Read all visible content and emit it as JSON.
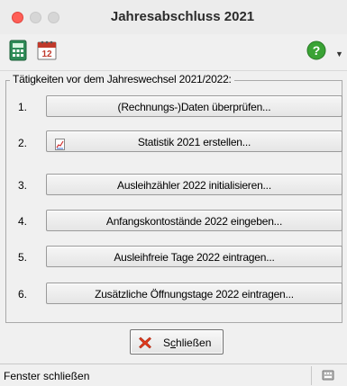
{
  "window": {
    "title": "Jahresabschluss 2021"
  },
  "toolbar": {
    "icons": [
      "calculator-icon",
      "calendar-icon",
      "help-icon"
    ],
    "calendar_day": "12"
  },
  "group": {
    "legend": "Tätigkeiten vor dem Jahreswechsel 2021/2022:"
  },
  "tasks": [
    {
      "num": "1.",
      "label": "(Rechnungs-)Daten überprüfen...",
      "icon": ""
    },
    {
      "num": "2.",
      "label": "Statistik 2021 erstellen...",
      "icon": "chart-document-icon"
    },
    {
      "num": "3.",
      "label": "Ausleihzähler 2022 initialisieren...",
      "icon": ""
    },
    {
      "num": "4.",
      "label": "Anfangskontostände 2022 eingeben...",
      "icon": ""
    },
    {
      "num": "5.",
      "label": "Ausleihfreie Tage 2022 eintragen...",
      "icon": ""
    },
    {
      "num": "6.",
      "label": "Zusätzliche Öffnungstage 2022 eintragen...",
      "icon": ""
    }
  ],
  "close_button": {
    "label_pre": "S",
    "label_underlined": "c",
    "label_post": "hließen"
  },
  "statusbar": {
    "text": "Fenster schließen"
  },
  "colors": {
    "window_bg": "#f0f0f0",
    "close_red": "#ff5f57",
    "help_green": "#3aa335"
  }
}
